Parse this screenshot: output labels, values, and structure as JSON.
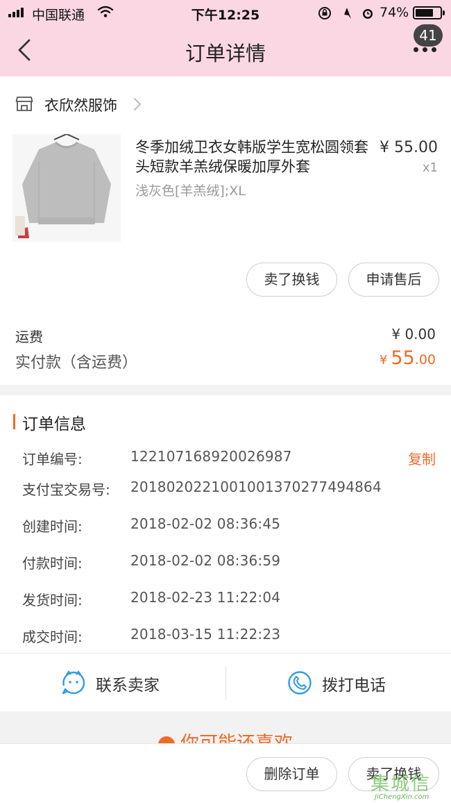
{
  "status_bar": {
    "carrier": "中国联通",
    "time": "下午12:25",
    "battery_percent": "74%",
    "battery_level": 0.74
  },
  "header": {
    "title": "订单详情",
    "back_icon": "chevron-left-icon",
    "more_icon": "more-dots-icon",
    "message_count": "41",
    "background": "#fbd7e4"
  },
  "shop": {
    "name": "衣欣然服饰",
    "icon": "store-icon"
  },
  "product": {
    "title": "冬季加绒卫衣女韩版学生宽松圆领套头短款羊羔绒保暖加厚外套",
    "sku": "浅灰色[羊羔绒];XL",
    "price": "¥ 55.00",
    "quantity": "x1"
  },
  "item_actions": {
    "resell": "卖了换钱",
    "after_sale": "申请售后"
  },
  "costs": {
    "shipping_label": "运费",
    "shipping_value": "¥ 0.00",
    "paid_label": "实付款（含运费）",
    "paid_currency": "¥",
    "paid_int": "55",
    "paid_dec": ".00"
  },
  "order_info": {
    "heading": "订单信息",
    "copy_label": "复制",
    "rows": [
      {
        "label": "订单编号:",
        "value": "122107168920026987"
      },
      {
        "label": "支付宝交易号:",
        "value": "2018020221001001370277494864"
      },
      {
        "label": "创建时间:",
        "value": "2018-02-02 08:36:45"
      },
      {
        "label": "付款时间:",
        "value": "2018-02-02 08:36:59"
      },
      {
        "label": "发货时间:",
        "value": "2018-02-23 11:22:04"
      },
      {
        "label": "成交时间:",
        "value": "2018-03-15 11:22:23"
      }
    ]
  },
  "contact": {
    "seller_label": "联系卖家",
    "seller_icon": "chat-bubble-icon",
    "phone_label": "拨打电话",
    "phone_icon": "phone-icon"
  },
  "recommend": {
    "title": "你可能还喜欢"
  },
  "bottom_actions": {
    "delete_label": "删除订单",
    "resell_label": "卖了换钱"
  },
  "watermark": {
    "logo": "集城信",
    "url": "JiChengXin.com"
  },
  "colors": {
    "accent": "#f06a26",
    "icon_blue": "#2f9be8"
  }
}
